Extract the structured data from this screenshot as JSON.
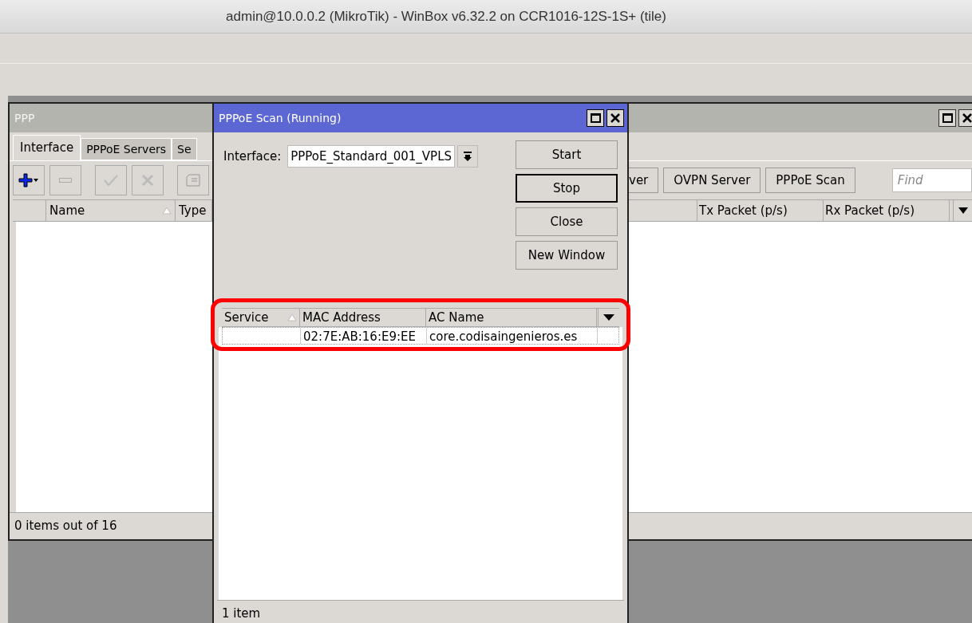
{
  "app_title": "admin@10.0.0.2 (MikroTik) - WinBox v6.32.2 on CCR1016-12S-1S+ (tile)",
  "ppp_window": {
    "title": "PPP",
    "tabs": [
      {
        "label": "Interface",
        "selected": true
      },
      {
        "label": "PPPoE Servers",
        "selected": false
      },
      {
        "label": "Se",
        "selected": false
      }
    ],
    "toolbar_buttons": [
      "ver",
      "OVPN Server",
      "PPPoE Scan"
    ],
    "find_placeholder": "Find",
    "columns_left": [
      {
        "label": "Name",
        "sorted": true
      },
      {
        "label": "Type",
        "sorted": false
      }
    ],
    "columns_right": [
      {
        "label": "Tx Packet (p/s)",
        "sorted": false
      },
      {
        "label": "Rx Packet (p/s)",
        "sorted": false
      }
    ],
    "status": "0 items out of 16"
  },
  "scan_window": {
    "title": "PPPoE Scan (Running)",
    "interface_label": "Interface:",
    "interface_value": "PPPoE_Standard_001_VPLS",
    "buttons": [
      {
        "label": "Start",
        "focused": false
      },
      {
        "label": "Stop",
        "focused": true
      },
      {
        "label": "Close",
        "focused": false
      },
      {
        "label": "New Window",
        "focused": false
      }
    ],
    "highlighted": true,
    "columns": [
      {
        "label": "Service",
        "sorted": true
      },
      {
        "label": "MAC Address",
        "sorted": false
      },
      {
        "label": "AC Name",
        "sorted": false
      }
    ],
    "rows": [
      {
        "mac_address": "02:7E:AB:16:E9:EE",
        "ac_name": "core.codisaingenieros.es"
      }
    ],
    "status": "1 item"
  }
}
